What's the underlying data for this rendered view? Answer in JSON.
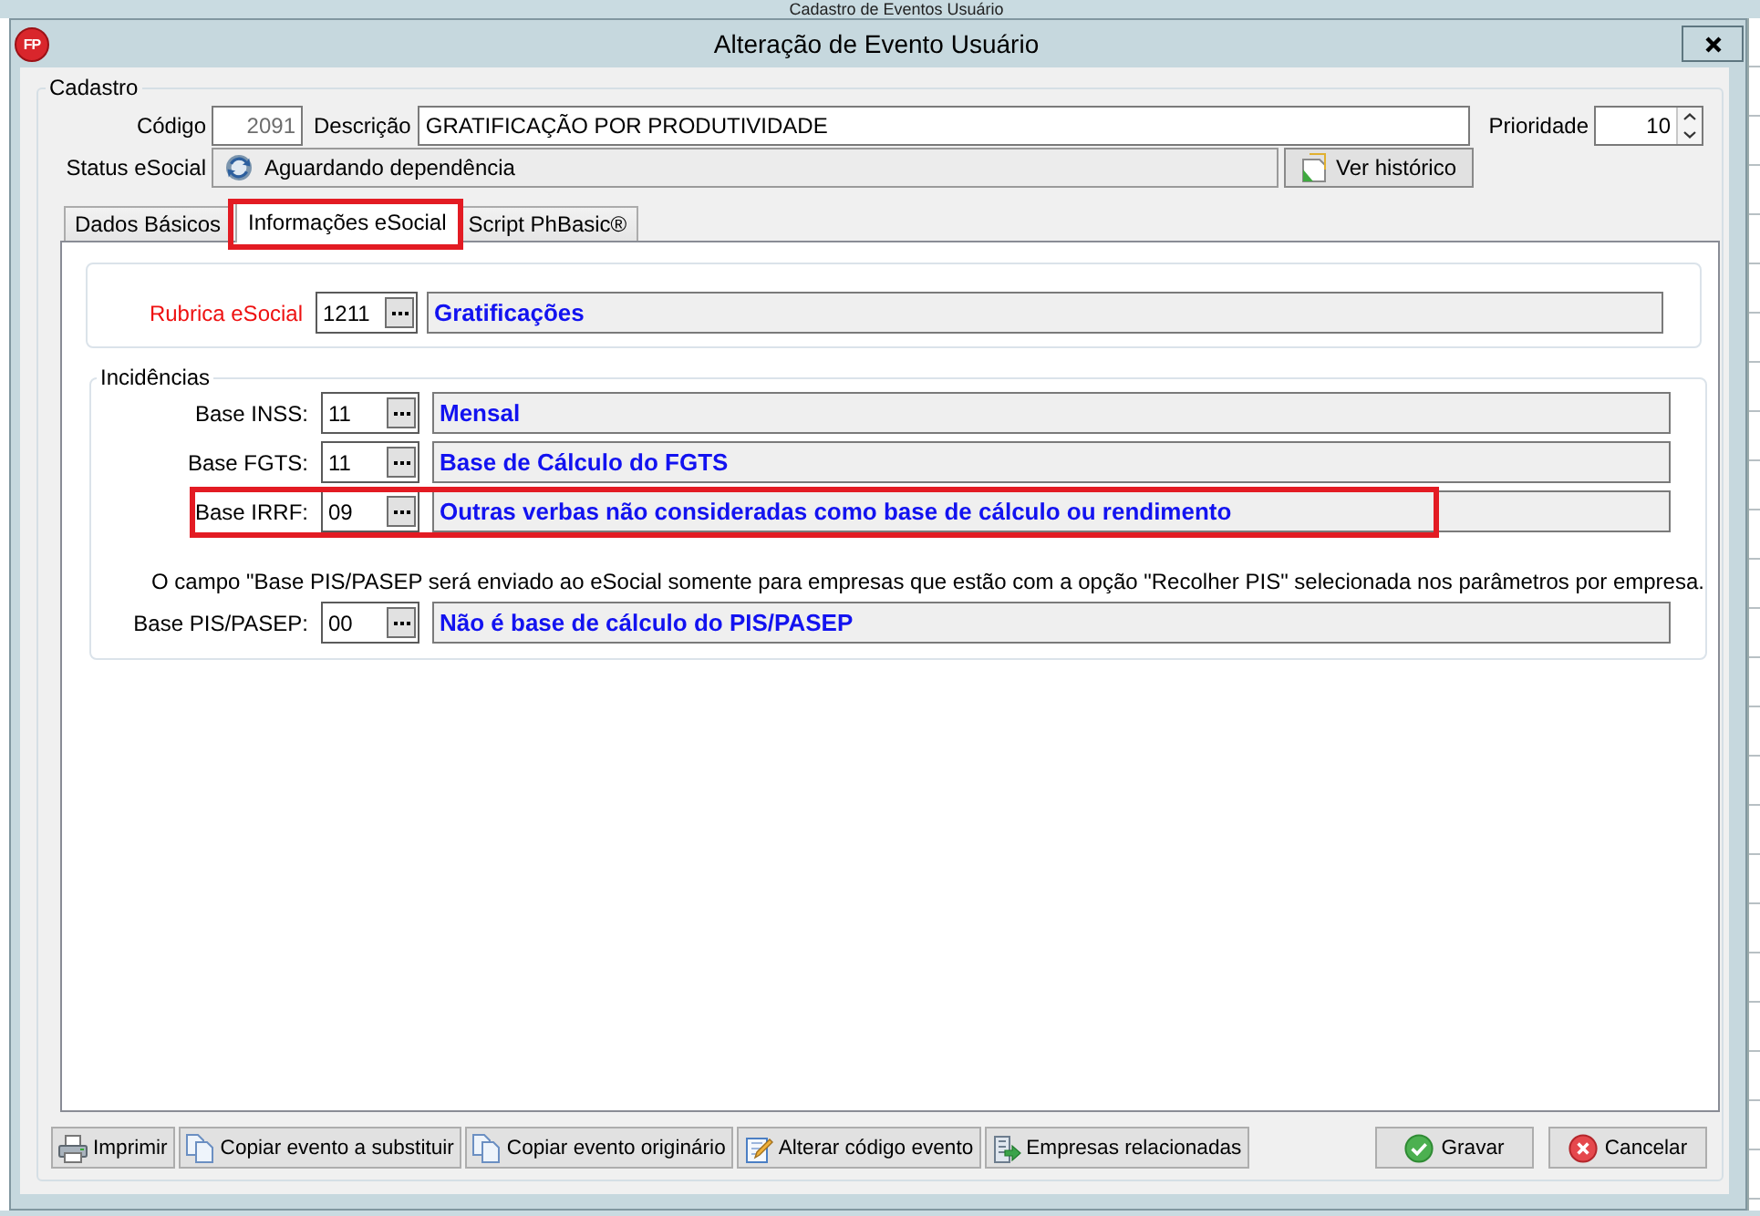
{
  "background_window": {
    "title": "Cadastro de Eventos Usuário"
  },
  "window": {
    "icon_text": "FP",
    "title": "Alteração de Evento Usuário"
  },
  "cadastro": {
    "legend": "Cadastro",
    "codigo": {
      "label": "Código",
      "value": "2091",
      "disabled": true
    },
    "descricao": {
      "label": "Descrição",
      "value": "GRATIFICAÇÃO POR PRODUTIVIDADE"
    },
    "prioridade": {
      "label": "Prioridade",
      "value": "10"
    },
    "status": {
      "label": "Status eSocial",
      "value": "Aguardando dependência"
    },
    "history_button": {
      "label": "Ver histórico"
    }
  },
  "tabs": [
    {
      "label": "Dados Básicos",
      "selected": false,
      "highlighted": false
    },
    {
      "label": "Informações eSocial",
      "selected": true,
      "highlighted": true
    },
    {
      "label": "Script PhBasic®",
      "selected": false,
      "highlighted": false
    }
  ],
  "rubrica": {
    "label": "Rubrica eSocial",
    "code": "1211",
    "description": "Gratificações"
  },
  "incidencias": {
    "legend": "Incidências",
    "items": [
      {
        "kind": "field",
        "label": "Base INSS:",
        "code": "11",
        "description": "Mensal",
        "highlighted": false
      },
      {
        "kind": "field",
        "label": "Base FGTS:",
        "code": "11",
        "description": "Base de Cálculo do FGTS",
        "highlighted": false
      },
      {
        "kind": "field",
        "label": "Base IRRF:",
        "code": "09",
        "description": "Outras verbas não consideradas como base de cálculo ou rendimento",
        "highlighted": true
      },
      {
        "kind": "note",
        "text": "O campo \"Base PIS/PASEP será enviado ao eSocial somente para empresas que estão com a opção \"Recolher PIS\" selecionada nos parâmetros por empresa."
      },
      {
        "kind": "field",
        "label": "Base PIS/PASEP:",
        "code": "00",
        "description": "Não é base de cálculo do PIS/PASEP",
        "highlighted": false
      }
    ]
  },
  "actions": [
    {
      "kind": "print",
      "label": "Imprimir"
    },
    {
      "kind": "copy",
      "label": "Copiar evento a substituir"
    },
    {
      "kind": "copy",
      "label": "Copiar evento originário"
    },
    {
      "kind": "edit",
      "label": "Alterar código evento"
    },
    {
      "kind": "companies",
      "label": "Empresas relacionadas"
    }
  ],
  "dialog_buttons": [
    {
      "kind": "save",
      "label": "Gravar"
    },
    {
      "kind": "cancel",
      "label": "Cancelar"
    }
  ]
}
